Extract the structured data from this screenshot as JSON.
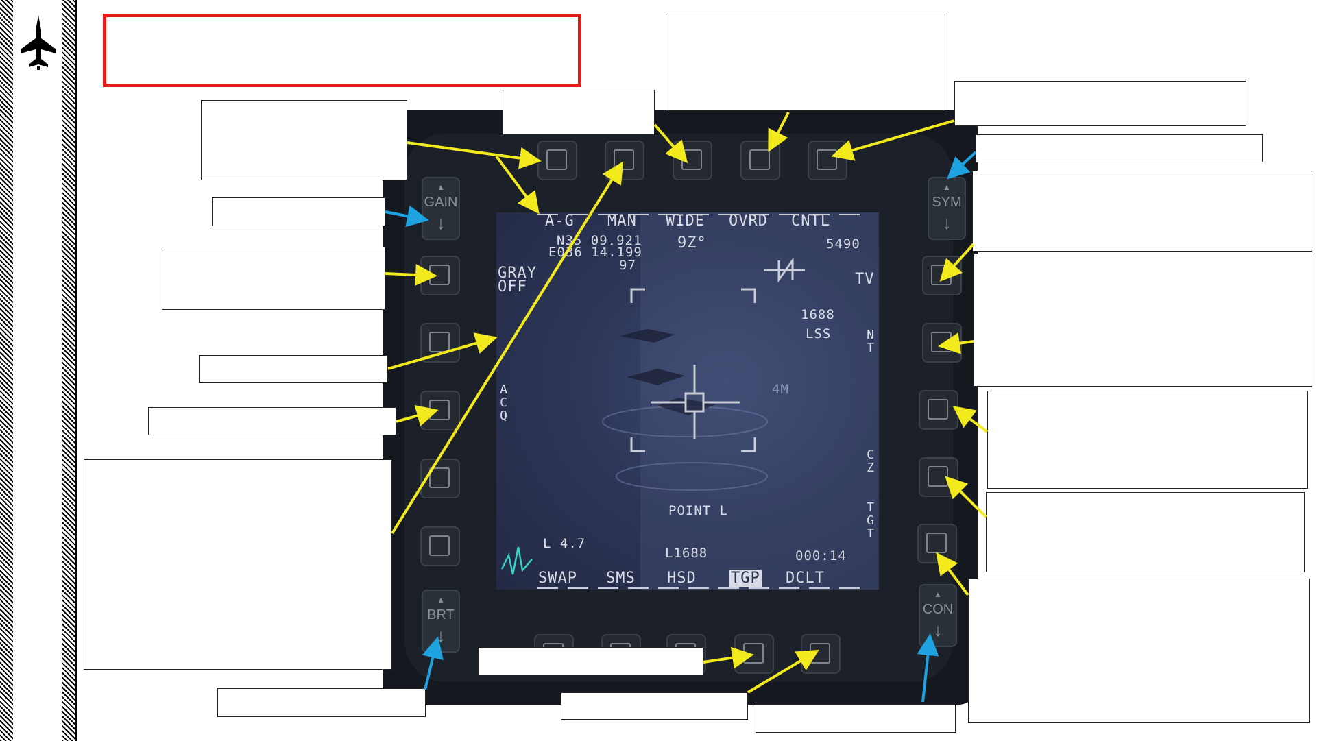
{
  "mfd": {
    "top_labels": [
      "A-G",
      "MAN",
      "WIDE",
      "OVRD",
      "CNTL"
    ],
    "bottom_labels": [
      "SWAP",
      "SMS",
      "HSD",
      "TGP",
      "DCLT"
    ],
    "left_labels": {
      "gray": "GRAY",
      "gray_state": "OFF",
      "acq": "ACQ"
    },
    "right_labels": {
      "tv": "TV",
      "nt": "NT",
      "cz": "CZ",
      "tgt": "TGT"
    },
    "coords": {
      "lat": "N35 09.921",
      "lon": "E036 14.199",
      "elev": "97"
    },
    "heading": "9Z°",
    "range_top": "5490",
    "laser_code": "1688",
    "lss": "LSS",
    "fov_marker": "4M",
    "point_mode": "POINT  L",
    "laser_arm": "L 4.7",
    "laser_readout": "L1688",
    "timer": "000:14",
    "rockers": {
      "gain": "GAIN",
      "sym": "SYM",
      "brt": "BRT",
      "con": "CON"
    }
  },
  "colors": {
    "arrow_yellow": "#f2ea1d",
    "arrow_blue": "#1ea3e0",
    "title_border": "#e21b1b",
    "symbology": "#d8dce4",
    "screen_bg": "#2d3658"
  }
}
